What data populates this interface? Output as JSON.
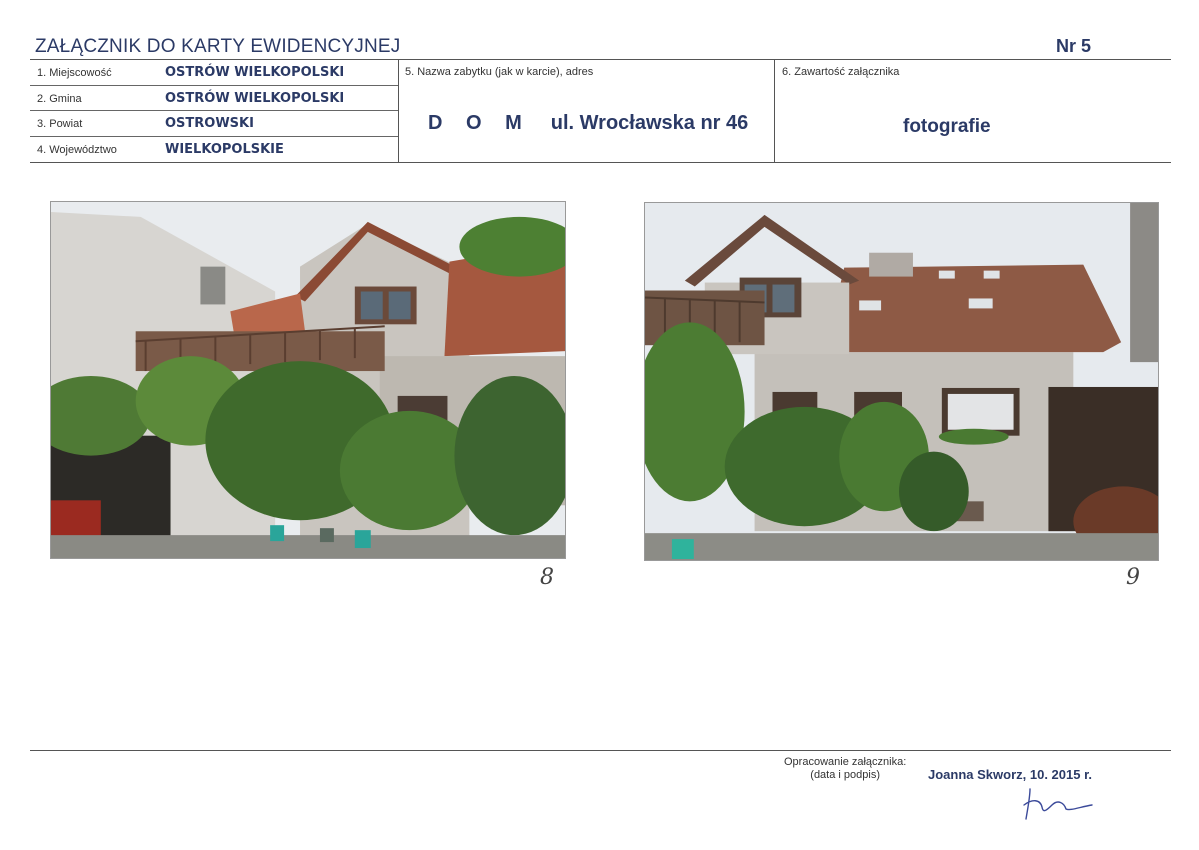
{
  "header": {
    "title": "ZAŁĄCZNIK DO KARTY EWIDENCYJNEJ",
    "number": "Nr 5"
  },
  "fields": [
    {
      "label": "1. Miejscowość",
      "value": "OSTRÓW WIELKOPOLSKI"
    },
    {
      "label": "2. Gmina",
      "value": "OSTRÓW WIELKOPOLSKI"
    },
    {
      "label": "3. Powiat",
      "value": "OSTROWSKI"
    },
    {
      "label": "4. Województwo",
      "value": "WIELKOPOLSKIE"
    }
  ],
  "monument": {
    "label": "5. Nazwa zabytku (jak w karcie), adres",
    "name": "D O M",
    "address": "ul. Wrocławska nr 46"
  },
  "content": {
    "label": "6. Zawartość załącznika",
    "value": "fotografie"
  },
  "photos": [
    {
      "number": "8"
    },
    {
      "number": "9"
    }
  ],
  "footer": {
    "label_line1": "Opracowanie załącznika:",
    "label_line2": "(data i podpis)",
    "author": "Joanna Skworz, 10. 2015 r."
  },
  "colors": {
    "heading": "#2b3a66",
    "rules": "#555555"
  }
}
